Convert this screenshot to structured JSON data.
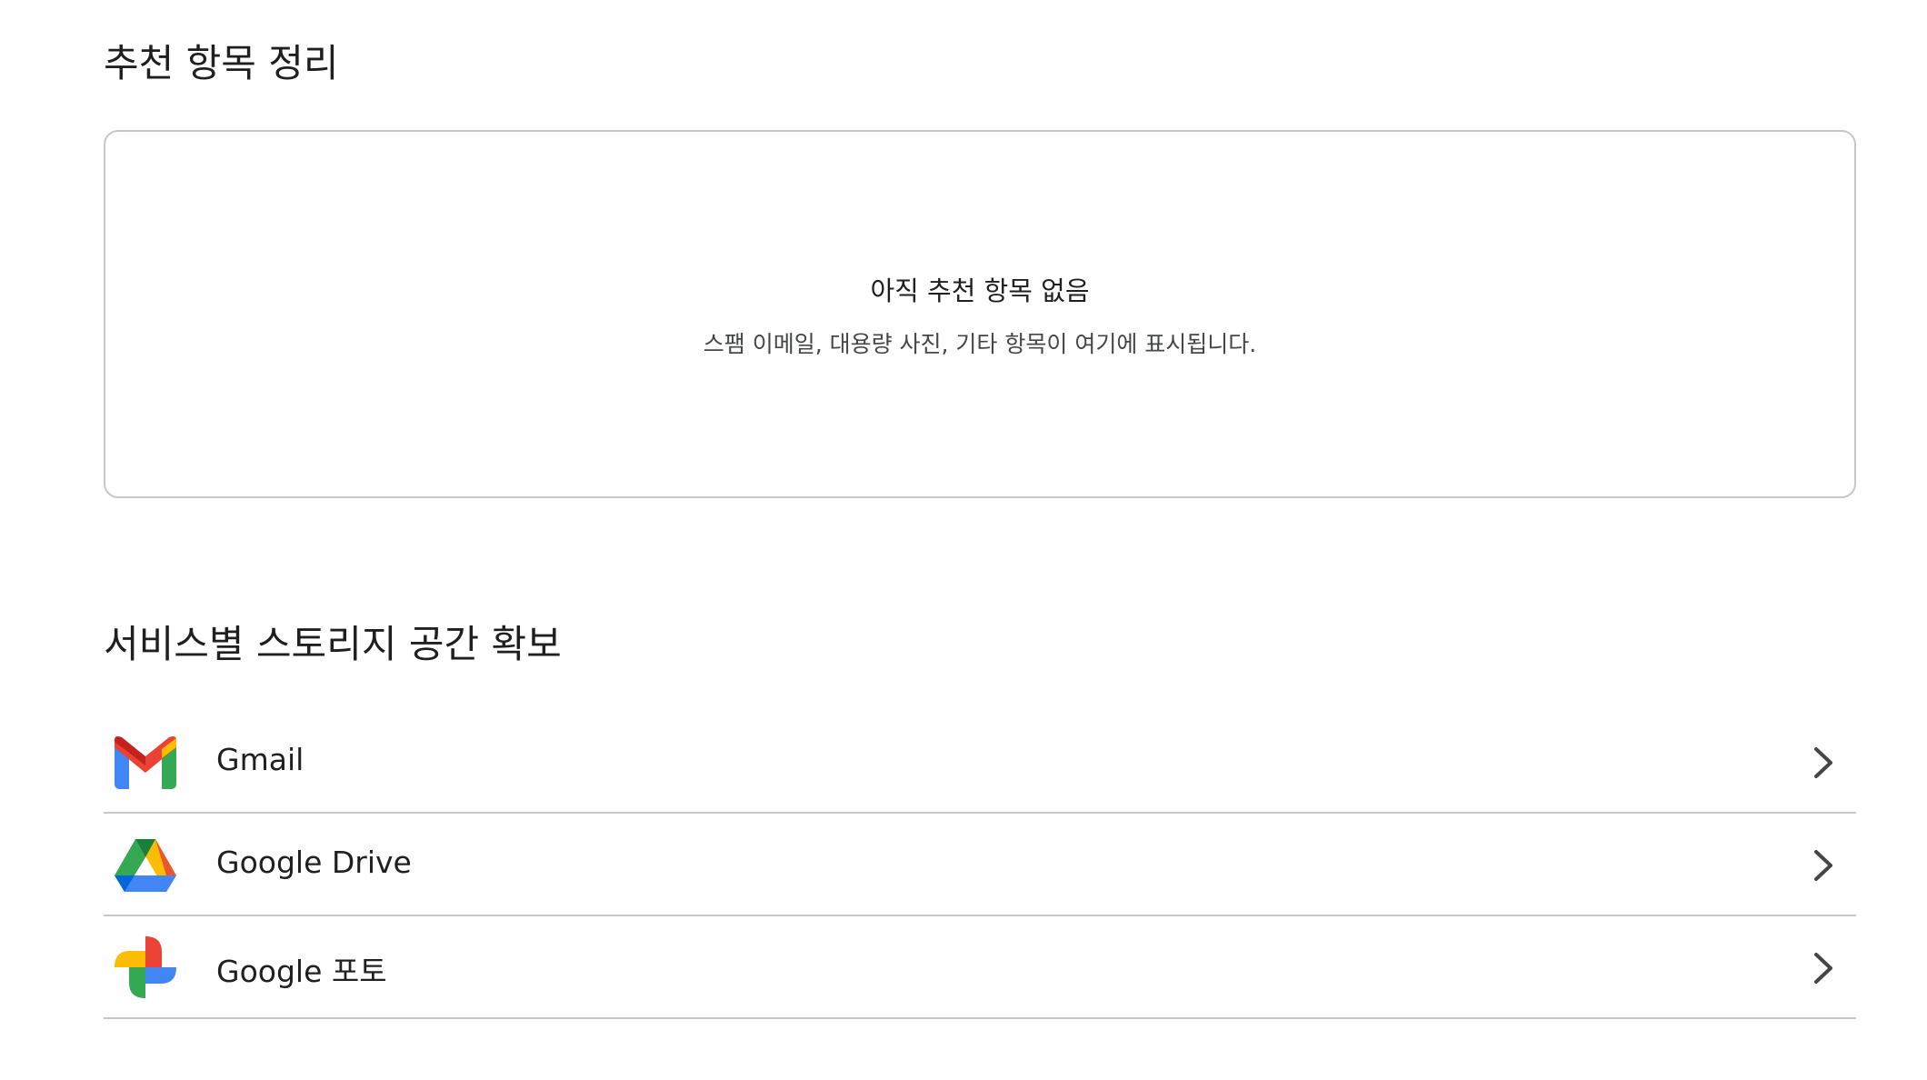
{
  "recommendations": {
    "title": "추천 항목 정리",
    "empty_title": "아직 추천 항목 없음",
    "empty_description": "스팸 이메일, 대용량 사진, 기타 항목이 여기에 표시됩니다."
  },
  "services": {
    "title": "서비스별 스토리지 공간 확보",
    "items": [
      {
        "label": "Gmail",
        "icon": "gmail-icon"
      },
      {
        "label": "Google Drive",
        "icon": "google-drive-icon"
      },
      {
        "label": "Google 포토",
        "icon": "google-photos-icon"
      }
    ]
  },
  "colors": {
    "google_blue": "#4285f4",
    "google_red": "#ea4335",
    "google_yellow": "#fbbc04",
    "google_green": "#34a853",
    "border": "#c7c7c7"
  }
}
